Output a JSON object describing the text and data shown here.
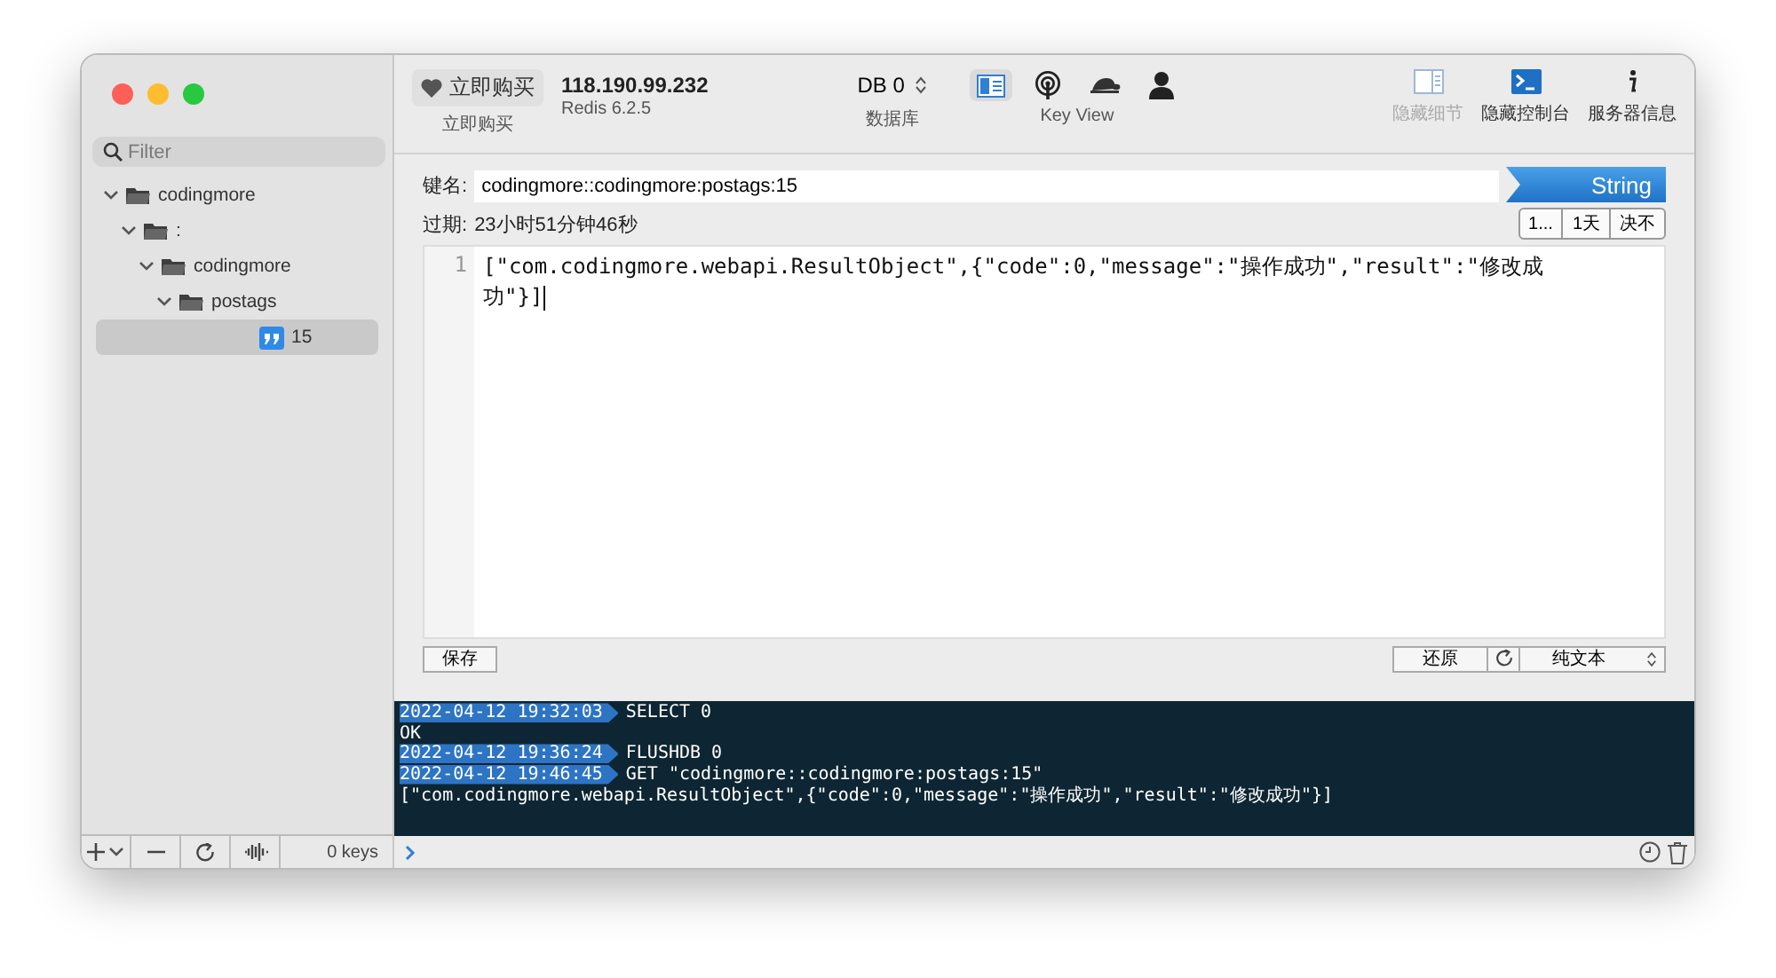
{
  "toolbar": {
    "buy": {
      "label": "立即购买",
      "caption": "立即购买"
    },
    "server": {
      "host": "118.190.99.232",
      "version": "Redis 6.2.5"
    },
    "database": {
      "value": "DB 0",
      "caption": "数据库"
    },
    "view_modes": [
      {
        "kind": "panel",
        "selected": true
      },
      {
        "kind": "antenna",
        "selected": false
      },
      {
        "kind": "turtle",
        "selected": false
      },
      {
        "kind": "person",
        "selected": false
      }
    ],
    "view_caption": "Key View",
    "actions": [
      {
        "kind": "panel",
        "label": "隐藏细节",
        "disabled": true
      },
      {
        "kind": "terminal",
        "label": "隐藏控制台",
        "disabled": false
      },
      {
        "kind": "info",
        "label": "服务器信息",
        "disabled": false
      }
    ]
  },
  "sidebar": {
    "filter": {
      "placeholder": "Filter"
    },
    "tree": [
      {
        "label": "codingmore",
        "kind": "folder",
        "expanded": true,
        "selected": false,
        "children": [
          {
            "label": ":",
            "kind": "folder",
            "expanded": true,
            "selected": false,
            "children": [
              {
                "label": "codingmore",
                "kind": "folder",
                "expanded": true,
                "selected": false,
                "children": [
                  {
                    "label": "postags",
                    "kind": "folder",
                    "expanded": true,
                    "selected": false,
                    "children": [
                      {
                        "label": "15",
                        "kind": "string",
                        "selected": true
                      }
                    ]
                  }
                ]
              }
            ]
          }
        ]
      }
    ],
    "key_count": "0 keys"
  },
  "key": {
    "label": "键名:",
    "value": "codingmore::codingmore:postags:15",
    "type": "String"
  },
  "ttl": {
    "label": "过期:",
    "value": "23小时51分钟46秒",
    "buttons": [
      "1...",
      "1天",
      "决不"
    ]
  },
  "editor": {
    "lines": [
      {
        "number": "1",
        "text": "[\"com.codingmore.webapi.ResultObject\",{\"code\":0,\"message\":\"操作成功\",\"result\":\"修改成功\"}]"
      }
    ],
    "save": "保存",
    "revert": "还原",
    "format": "纯文本"
  },
  "console": {
    "lines": [
      {
        "kind": "command",
        "time": "2022-04-12 19:32:03",
        "text": "SELECT 0"
      },
      {
        "kind": "output",
        "text": "OK"
      },
      {
        "kind": "command",
        "time": "2022-04-12 19:36:24",
        "text": "FLUSHDB 0"
      },
      {
        "kind": "command",
        "time": "2022-04-12 19:46:45",
        "text": "GET \"codingmore::codingmore:postags:15\""
      },
      {
        "kind": "output",
        "text": "[\"com.codingmore.webapi.ResultObject\",{\"code\":0,\"message\":\"操作成功\",\"result\":\"修改成功\"}]"
      }
    ]
  }
}
